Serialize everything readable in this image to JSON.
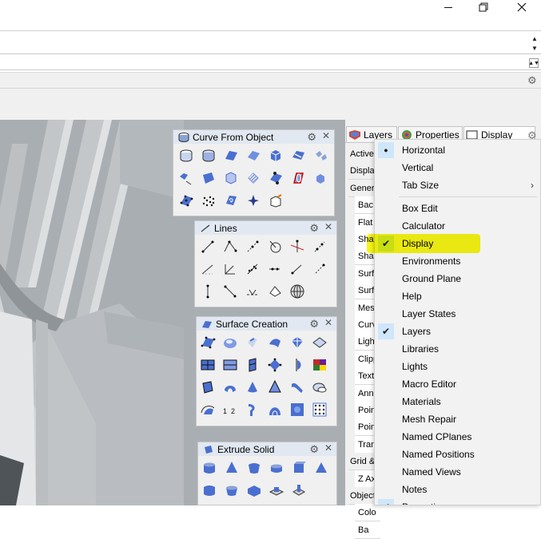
{
  "window": {
    "minimize_label": "—",
    "maximize_label": "□",
    "close_label": "✕"
  },
  "toolbars": {
    "curve_from_object": {
      "title": "Curve From Object"
    },
    "lines": {
      "title": "Lines"
    },
    "surface_creation": {
      "title": "Surface Creation"
    },
    "extrude_solid": {
      "title": "Extrude Solid"
    }
  },
  "panel": {
    "tabs": [
      {
        "label": "Layers",
        "icon": "layers-icon"
      },
      {
        "label": "Properties",
        "icon": "properties-icon"
      },
      {
        "label": "Display",
        "icon": "display-icon"
      }
    ],
    "rows": [
      {
        "label": "Active",
        "kind": "section"
      },
      {
        "label": "Displa",
        "kind": "section"
      },
      {
        "label": "Gener",
        "kind": "section"
      },
      {
        "label": "Bac",
        "kind": "sub"
      },
      {
        "label": "Flat",
        "kind": "sub"
      },
      {
        "label": "Sha",
        "kind": "sub"
      },
      {
        "label": "Sha",
        "kind": "sub"
      },
      {
        "label": "Surf",
        "kind": "sub"
      },
      {
        "label": "Surf",
        "kind": "sub"
      },
      {
        "label": "Mes",
        "kind": "sub"
      },
      {
        "label": "Curv",
        "kind": "sub"
      },
      {
        "label": "Ligh",
        "kind": "sub"
      },
      {
        "label": "Clipp",
        "kind": "sub"
      },
      {
        "label": "Text",
        "kind": "sub"
      },
      {
        "label": "Ann",
        "kind": "sub"
      },
      {
        "label": "Poin",
        "kind": "sub"
      },
      {
        "label": "Poin",
        "kind": "sub"
      },
      {
        "label": "Tran",
        "kind": "sub"
      },
      {
        "label": "Grid &",
        "kind": "section"
      },
      {
        "label": "Z Ax",
        "kind": "sub"
      },
      {
        "label": "Object",
        "kind": "section"
      },
      {
        "label": "Colo",
        "kind": "sub"
      },
      {
        "label": "Ba",
        "kind": "sub"
      }
    ]
  },
  "menu": {
    "items": [
      {
        "label": "Horizontal",
        "state": "radio"
      },
      {
        "label": "Vertical",
        "state": "none"
      },
      {
        "label": "Tab Size",
        "state": "submenu"
      },
      {
        "label": "Box Edit",
        "state": "none"
      },
      {
        "label": "Calculator",
        "state": "none"
      },
      {
        "label": "Display",
        "state": "checked"
      },
      {
        "label": "Environments",
        "state": "none"
      },
      {
        "label": "Ground Plane",
        "state": "none"
      },
      {
        "label": "Help",
        "state": "none"
      },
      {
        "label": "Layer States",
        "state": "none"
      },
      {
        "label": "Layers",
        "state": "checked"
      },
      {
        "label": "Libraries",
        "state": "none"
      },
      {
        "label": "Lights",
        "state": "none"
      },
      {
        "label": "Macro Editor",
        "state": "none"
      },
      {
        "label": "Materials",
        "state": "none"
      },
      {
        "label": "Mesh Repair",
        "state": "none"
      },
      {
        "label": "Named CPlanes",
        "state": "none"
      },
      {
        "label": "Named Positions",
        "state": "none"
      },
      {
        "label": "Named Views",
        "state": "none"
      },
      {
        "label": "Notes",
        "state": "none"
      },
      {
        "label": "Properties",
        "state": "checked"
      }
    ],
    "highlighted_item": "Display",
    "highlight_color": "#f6f500"
  },
  "colors": {
    "viewport_bg": "#a9aeb3",
    "toolbar_title_bg": "#e1e8f1",
    "check_bg": "#cfe6fb",
    "icon_blue": "#4a6fd0"
  }
}
